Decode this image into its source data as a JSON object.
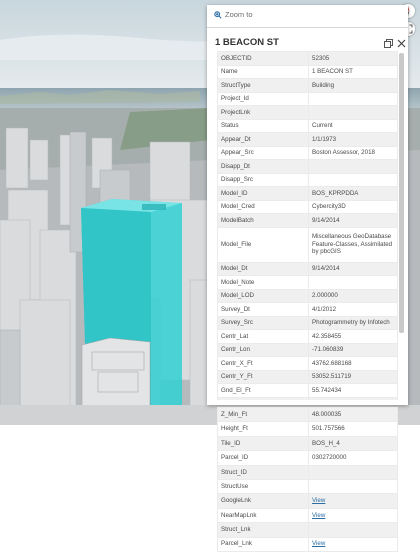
{
  "popup": {
    "zoom_label": "Zoom to",
    "title": "1 BEACON ST",
    "colors": {
      "accent": "#2b6ea5",
      "highlight": "#35d0d3"
    },
    "fields": [
      {
        "name": "OBJECTID",
        "value": "52305"
      },
      {
        "name": "Name",
        "value": "1 BEACON ST"
      },
      {
        "name": "StructType",
        "value": "Building"
      },
      {
        "name": "Project_Id",
        "value": ""
      },
      {
        "name": "ProjectLnk",
        "value": ""
      },
      {
        "name": "Status",
        "value": "Current"
      },
      {
        "name": "Appear_Dt",
        "value": "1/1/1973"
      },
      {
        "name": "Appear_Src",
        "value": "Boston Assessor, 2018"
      },
      {
        "name": "Disapp_Dt",
        "value": ""
      },
      {
        "name": "Disapp_Src",
        "value": ""
      },
      {
        "name": "Model_ID",
        "value": "BOS_KPRPDDA"
      },
      {
        "name": "Model_Cred",
        "value": "Cybercity3D"
      },
      {
        "name": "ModelBatch",
        "value": "9/14/2014"
      },
      {
        "name": "Model_File",
        "value": "Miscellaneous GeoDatabase Feature-Classes, Assimilated by pbcGIS"
      },
      {
        "name": "Model_Dt",
        "value": "9/14/2014"
      },
      {
        "name": "Model_Note",
        "value": ""
      },
      {
        "name": "Model_LOD",
        "value": "2.000000"
      },
      {
        "name": "Survey_Dt",
        "value": "4/1/2012"
      },
      {
        "name": "Survey_Src",
        "value": "Photogrammetry by Infotech"
      },
      {
        "name": "Centr_Lat",
        "value": "42.358455"
      },
      {
        "name": "Centr_Lon",
        "value": "-71.060839"
      },
      {
        "name": "Centr_X_Ft",
        "value": "43762.688168"
      },
      {
        "name": "Centr_Y_Ft",
        "value": "53052.511719"
      },
      {
        "name": "Gnd_El_Ft",
        "value": "55.742434"
      },
      {
        "name": "Z_Max_Ft",
        "value": "557.500000"
      }
    ],
    "more_fields": [
      {
        "name": "Z_Min_Ft",
        "value": "48.000035"
      },
      {
        "name": "Height_Ft",
        "value": "501.757566"
      },
      {
        "name": "Tile_ID",
        "value": "BOS_H_4"
      },
      {
        "name": "Parcel_ID",
        "value": "0302720000"
      },
      {
        "name": "Struct_ID",
        "value": ""
      },
      {
        "name": "StructUse",
        "value": ""
      },
      {
        "name": "GoogleLnk",
        "value": "View"
      },
      {
        "name": "NearMapLnk",
        "value": "View"
      },
      {
        "name": "Struct_Lnk",
        "value": ""
      },
      {
        "name": "Parcel_Lnk",
        "value": "View"
      }
    ]
  },
  "icons": {
    "zoom": "zoom-to-icon",
    "dock": "dock-icon",
    "close": "close-icon",
    "compass": "compass-icon",
    "fullscreen": "fullscreen-icon"
  }
}
